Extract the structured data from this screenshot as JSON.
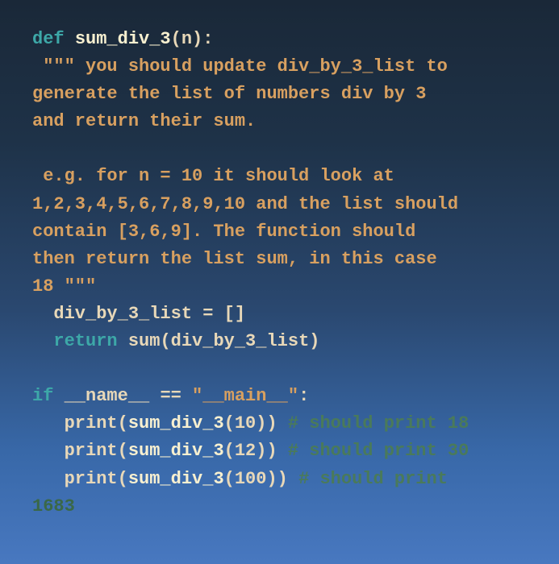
{
  "code": {
    "l01_kw_def": "def",
    "l01_fn": "sum_div_3",
    "l01_sig": "(n):",
    "l02_doc_open": " \"\"\" ",
    "l02_doc_text": "you should update div_by_3_list to",
    "l03_doc": "generate the list of numbers div by 3",
    "l04_doc": "and return their sum.",
    "l05_blank": "",
    "l06_doc": " e.g. for n = 10 it should look at",
    "l07_doc": "1,2,3,4,5,6,7,8,9,10 and the list should",
    "l08_doc": "contain [3,6,9]. The function should",
    "l09_doc": "then return the list sum, in this case",
    "l10_doc_end": "18 \"\"\"",
    "l11_assign": "  div_by_3_list = []",
    "l12_kw_return": "return",
    "l12_call_a": " sum",
    "l12_call_b": "(div_by_3_list)",
    "l13_blank": "",
    "l14_kw_if": "if",
    "l14_name": " __name__ ",
    "l14_op": "==",
    "l14_str": " \"__main__\"",
    "l14_colon": ":",
    "l15_print": "   print",
    "l15_call_a": "(",
    "l15_fn": "sum_div_3",
    "l15_arg": "(10",
    "l15_close": "))",
    "l15_space": " ",
    "l15_cmt": "# should print 18",
    "l16_print": "   print",
    "l16_call_a": "(",
    "l16_fn": "sum_div_3",
    "l16_arg": "(12",
    "l16_close": "))",
    "l16_space": " ",
    "l16_cmt": "# should print 30",
    "l17_print": "   print",
    "l17_call_a": "(",
    "l17_fn": "sum_div_3",
    "l17_arg": "(100",
    "l17_close": "))",
    "l17_space": " ",
    "l17_cmt": "# should print",
    "l18_cut": "1683"
  }
}
